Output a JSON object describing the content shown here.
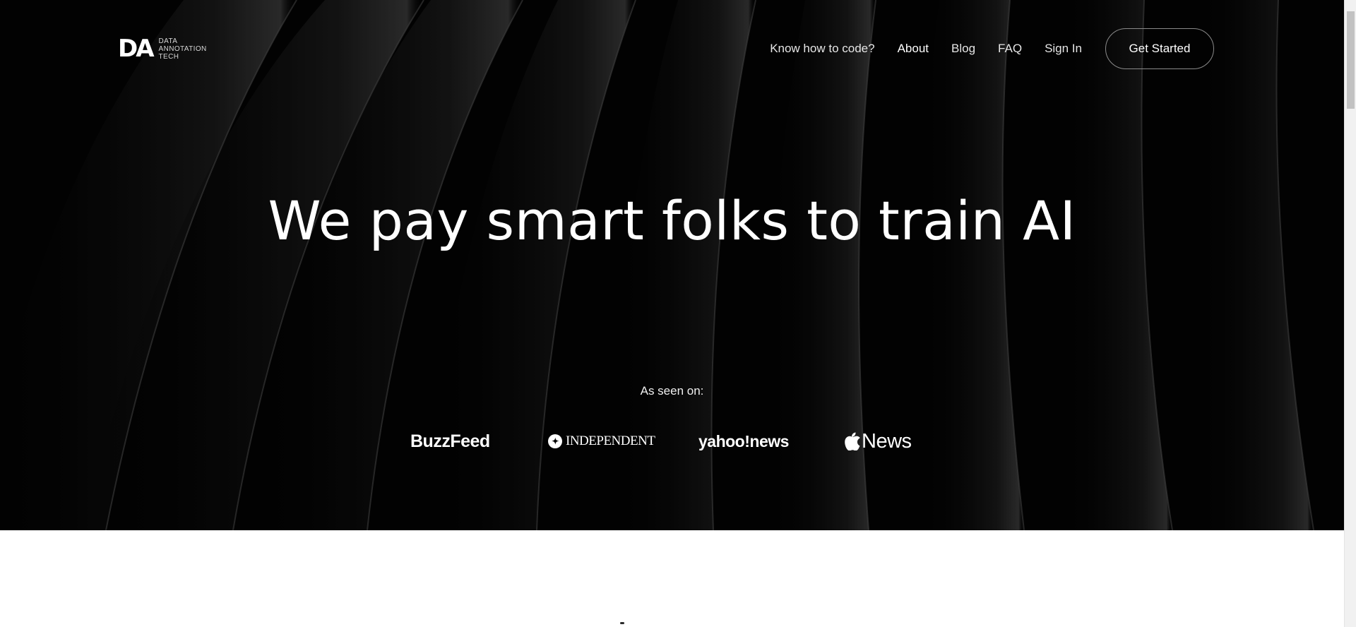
{
  "logo": {
    "mark": "DA",
    "lines": [
      "DATA",
      "ANNOTATION",
      "TECH"
    ]
  },
  "nav": {
    "items": [
      {
        "label": "Know how to code?"
      },
      {
        "label": "About"
      },
      {
        "label": "Blog"
      },
      {
        "label": "FAQ"
      },
      {
        "label": "Sign In"
      }
    ],
    "cta_label": "Get Started"
  },
  "hero": {
    "headline": "We pay smart folks to train AI",
    "seen_on": "As seen on:",
    "press": [
      {
        "label": "BuzzFeed"
      },
      {
        "label": "INDEPENDENT"
      },
      {
        "label": "yahoo!news"
      },
      {
        "label": "News"
      }
    ]
  },
  "colors": {
    "hero_bg": "#030303",
    "text": "#ffffff",
    "page_bg": "#ffffff"
  }
}
